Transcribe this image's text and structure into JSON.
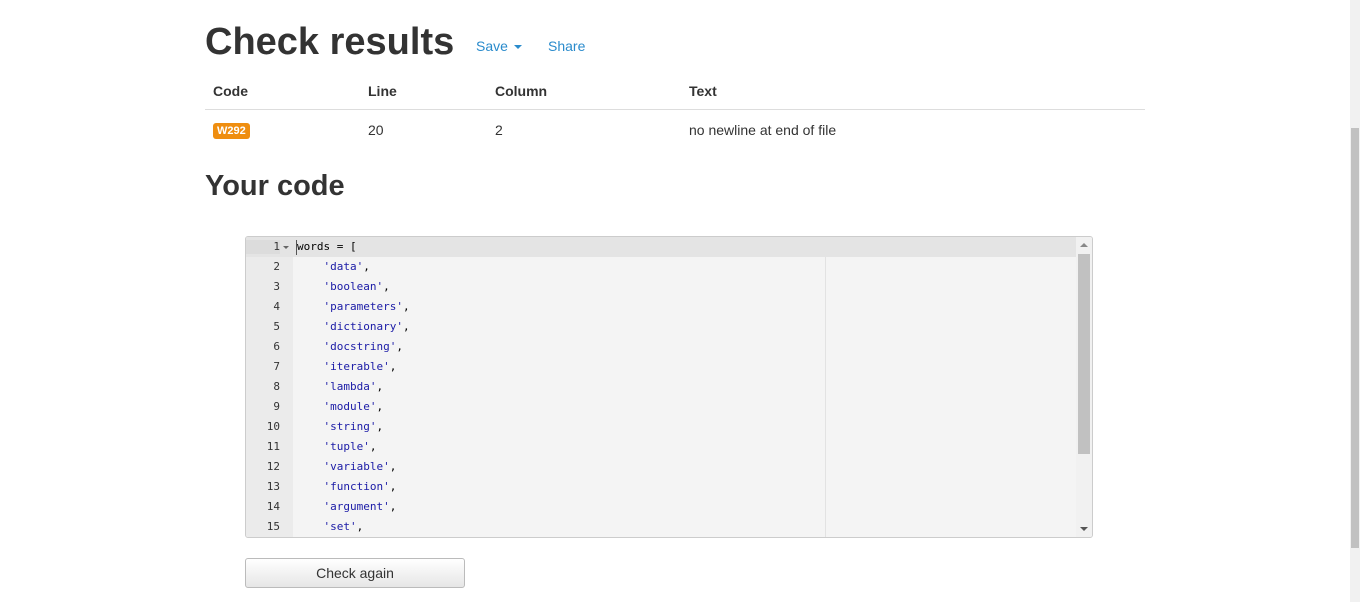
{
  "header": {
    "title": "Check results",
    "save_label": "Save",
    "share_label": "Share"
  },
  "results_table": {
    "columns": [
      "Code",
      "Line",
      "Column",
      "Text"
    ],
    "rows": [
      {
        "code": "W292",
        "line": "20",
        "column": "2",
        "text": "no newline at end of file"
      }
    ]
  },
  "code_section": {
    "title": "Your code",
    "lines": [
      {
        "num": "1",
        "pre": "words = [",
        "str": "",
        "post": ""
      },
      {
        "num": "2",
        "pre": "    ",
        "str": "'data'",
        "post": ","
      },
      {
        "num": "3",
        "pre": "    ",
        "str": "'boolean'",
        "post": ","
      },
      {
        "num": "4",
        "pre": "    ",
        "str": "'parameters'",
        "post": ","
      },
      {
        "num": "5",
        "pre": "    ",
        "str": "'dictionary'",
        "post": ","
      },
      {
        "num": "6",
        "pre": "    ",
        "str": "'docstring'",
        "post": ","
      },
      {
        "num": "7",
        "pre": "    ",
        "str": "'iterable'",
        "post": ","
      },
      {
        "num": "8",
        "pre": "    ",
        "str": "'lambda'",
        "post": ","
      },
      {
        "num": "9",
        "pre": "    ",
        "str": "'module'",
        "post": ","
      },
      {
        "num": "10",
        "pre": "    ",
        "str": "'string'",
        "post": ","
      },
      {
        "num": "11",
        "pre": "    ",
        "str": "'tuple'",
        "post": ","
      },
      {
        "num": "12",
        "pre": "    ",
        "str": "'variable'",
        "post": ","
      },
      {
        "num": "13",
        "pre": "    ",
        "str": "'function'",
        "post": ","
      },
      {
        "num": "14",
        "pre": "    ",
        "str": "'argument'",
        "post": ","
      },
      {
        "num": "15",
        "pre": "    ",
        "str": "'set'",
        "post": ","
      }
    ]
  },
  "actions": {
    "check_again_label": "Check again"
  },
  "colors": {
    "link": "#2a8bcc",
    "badge_warning": "#ef8e10",
    "code_string": "#1a1aa6"
  },
  "icons": {
    "save_dropdown": "caret-down-icon",
    "fold": "fold-arrow-icon",
    "scroll_up": "scroll-up-icon",
    "scroll_down": "scroll-down-icon"
  }
}
